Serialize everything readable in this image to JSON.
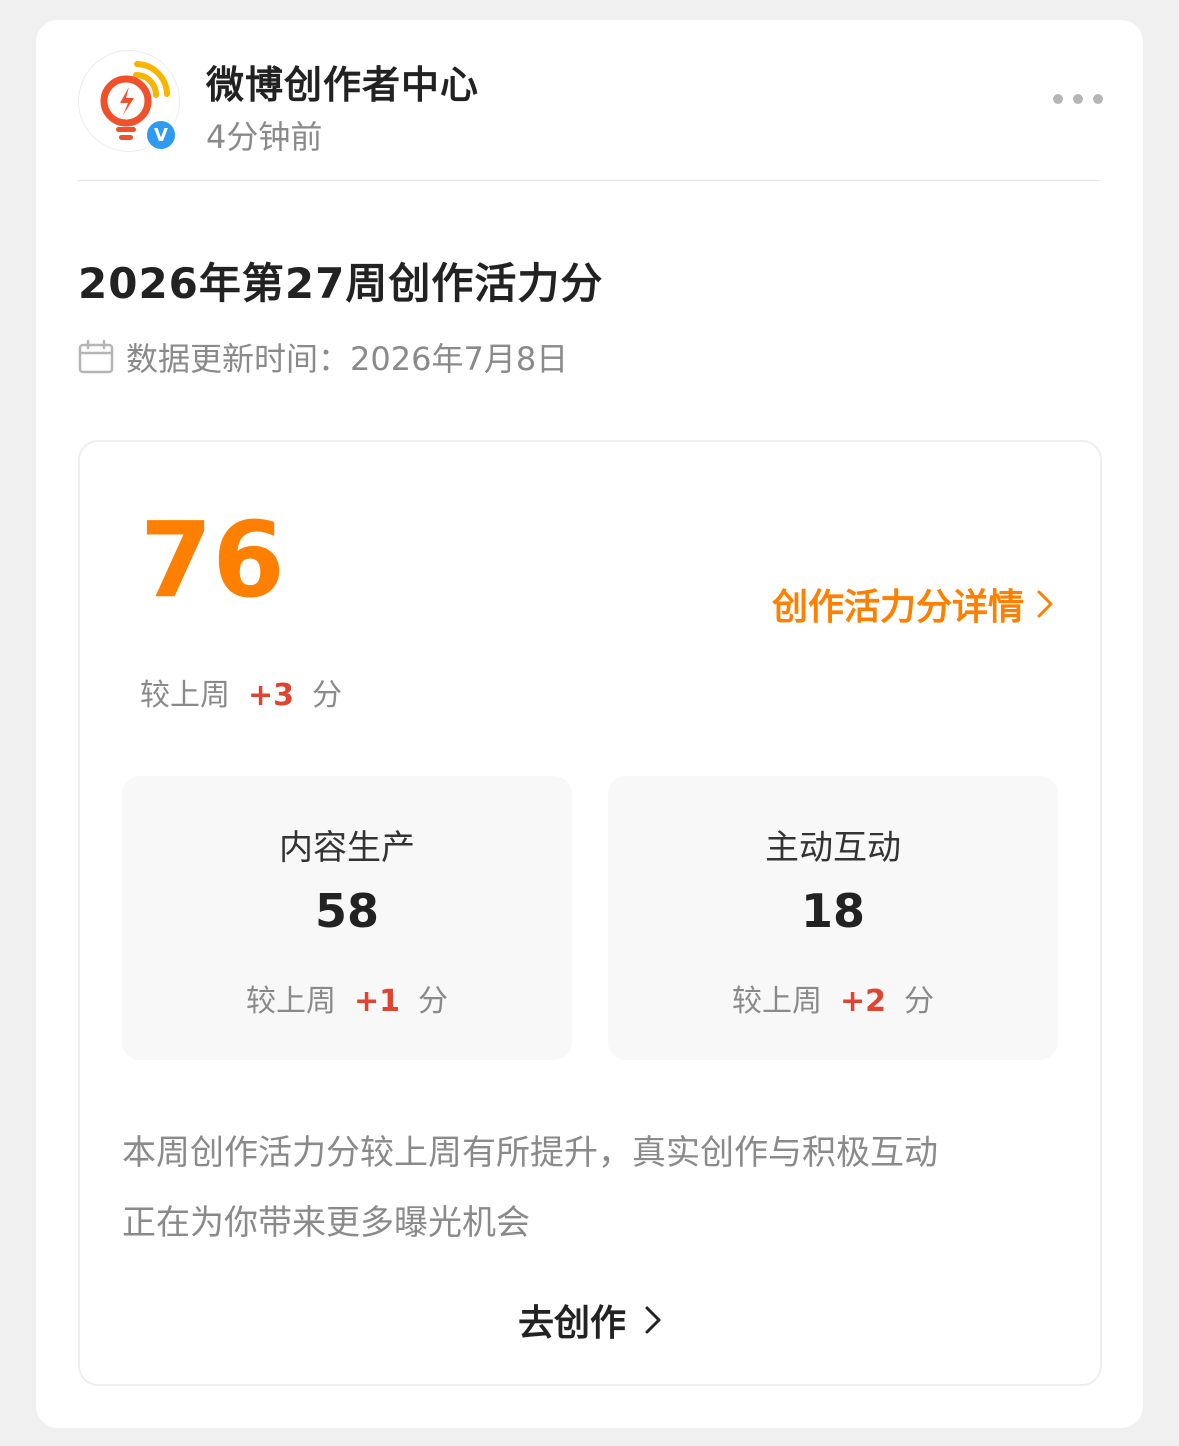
{
  "header": {
    "account_name": "微博创作者中心",
    "post_time": "4分钟前",
    "verified_mark": "V"
  },
  "report": {
    "title": "2026年第27周创作活力分",
    "update_label": "数据更新时间：",
    "update_date": "2026年7月8日"
  },
  "score": {
    "value": "76",
    "detail_link": "创作活力分详情",
    "compare_prefix": "较上周",
    "delta": "+3",
    "unit": "分"
  },
  "metrics": [
    {
      "label": "内容生产",
      "value": "58",
      "compare_prefix": "较上周",
      "delta": "+1",
      "unit": "分"
    },
    {
      "label": "主动互动",
      "value": "18",
      "compare_prefix": "较上周",
      "delta": "+2",
      "unit": "分"
    }
  ],
  "summary": {
    "line1": "本周创作活力分较上周有所提升，真实创作与积极互动",
    "line2": "正在为你带来更多曝光机会"
  },
  "cta": {
    "label": "去创作"
  },
  "colors": {
    "accent": "#ff7f00",
    "delta": "#e0432f",
    "verified": "#2f9bf0"
  },
  "icons": {
    "avatar": "lightbulb-lightning-logo",
    "verified": "verified-badge-icon",
    "more": "more-dots-icon",
    "calendar": "calendar-icon",
    "chevron": "chevron-right-icon"
  }
}
